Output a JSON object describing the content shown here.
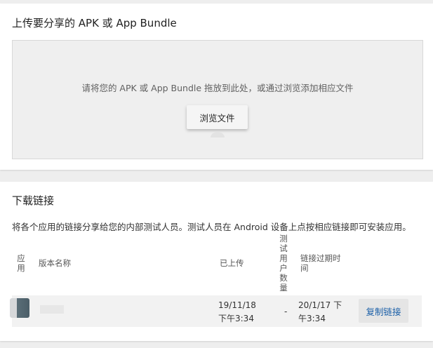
{
  "upload": {
    "title": "上传要分享的 APK 或 App Bundle",
    "dropzone_text": "请将您的 APK 或 App Bundle 拖放到此处，或通过浏览添加相应文件",
    "browse_label": "浏览文件"
  },
  "links": {
    "title": "下载链接",
    "description": "将各个应用的链接分享给您的内部测试人员。测试人员在 Android 设备上点按相应链接即可安装应用。",
    "columns": {
      "app": "应用",
      "version_name": "版本名称",
      "uploaded": "已上传",
      "tester_count": "测试用户数量",
      "expiry": "链接过期时间"
    },
    "rows": [
      {
        "uploaded": "19/11/18 下午3:34",
        "tester_count": "-",
        "expiry": "20/1/17 下午3:34",
        "action_label": "复制链接"
      }
    ]
  }
}
